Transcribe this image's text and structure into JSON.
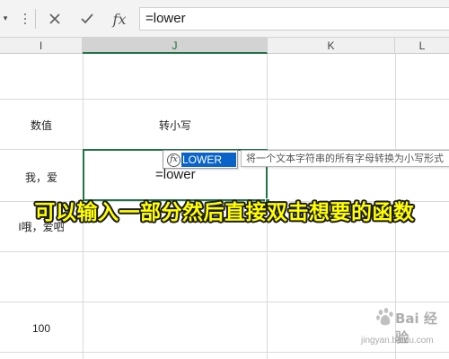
{
  "formula_bar": {
    "cancel_icon": "close-x-icon",
    "enter_icon": "checkmark-icon",
    "fx_label": "fx",
    "value": "=lower"
  },
  "columns": [
    {
      "label": "I"
    },
    {
      "label": "J",
      "active": true
    },
    {
      "label": "K"
    },
    {
      "label": "L"
    }
  ],
  "cells": {
    "header_value": "数值",
    "header_lower": "转小写",
    "row1_value": "我，爱",
    "row2_value": "I哦，爱呬",
    "row3_value": "100",
    "editing_text": "=lower"
  },
  "autocomplete": {
    "item": "LOWER",
    "tooltip": "将一个文本字符串的所有字母转换为小写形式"
  },
  "caption": "可以输入一部分然后直接双击想要的函数",
  "watermark": {
    "brand": "Bai 经验",
    "domain": "jingyan.baidu.com"
  },
  "colors": {
    "accent_green": "#217346",
    "autocomplete_highlight": "#0a64c8",
    "caption_yellow": "#ffff00"
  }
}
